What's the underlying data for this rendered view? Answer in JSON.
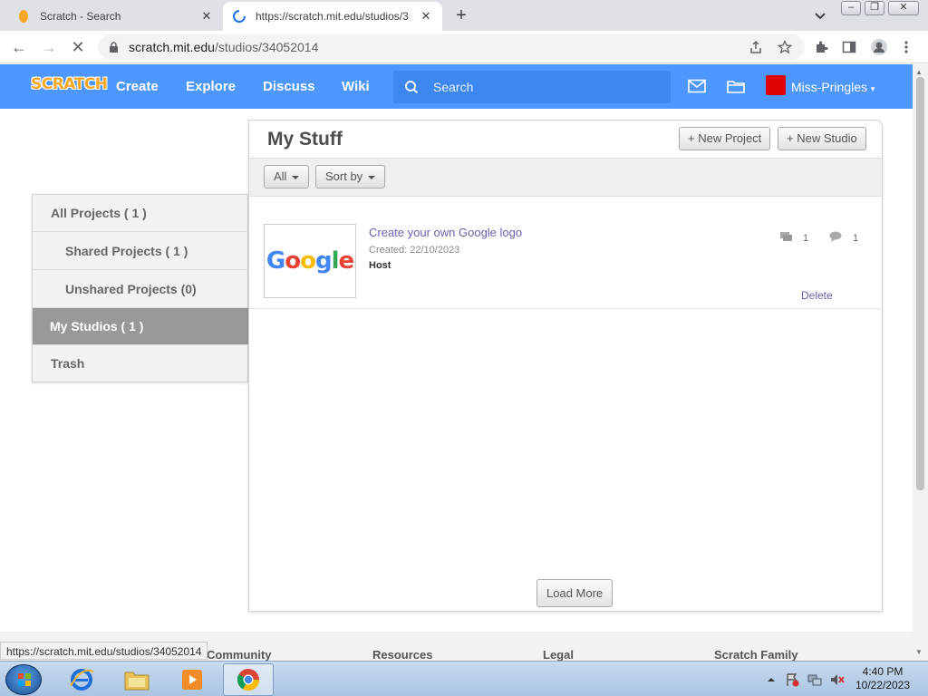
{
  "browser": {
    "tabs": [
      {
        "title": "Scratch - Search",
        "active": false
      },
      {
        "title": "https://scratch.mit.edu/studios/3",
        "active": true
      }
    ],
    "url_host": "scratch.mit.edu",
    "url_path": "/studios/34052014",
    "status_url": "https://scratch.mit.edu/studios/34052014"
  },
  "scratch_nav": {
    "logo": "SCRATCH",
    "links": [
      "Create",
      "Explore",
      "Discuss",
      "Wiki"
    ],
    "search_placeholder": "Search",
    "username": "Miss-Pringles"
  },
  "sidebar": {
    "items": [
      {
        "label": "All Projects ( 1 )",
        "selected": false
      },
      {
        "label": "Shared Projects ( 1 )",
        "selected": false
      },
      {
        "label": "Unshared Projects (0)",
        "selected": false
      },
      {
        "label": "My Studios ( 1 )",
        "selected": true
      },
      {
        "label": "Trash",
        "selected": false
      }
    ]
  },
  "main": {
    "title": "My Stuff",
    "new_project": "+ New Project",
    "new_studio": "+ New Studio",
    "filter_all": "All",
    "sort_by": "Sort by",
    "item": {
      "thumb_text": "Google",
      "title": "Create your own Google logo",
      "created": "Created: 22/10/2023",
      "role": "Host",
      "projects_count": "1",
      "comments_count": "1",
      "delete": "Delete"
    },
    "load_more": "Load More"
  },
  "footer": {
    "headings": [
      "Community",
      "Resources",
      "Legal",
      "Scratch Family"
    ]
  },
  "taskbar": {
    "time": "4:40 PM",
    "date": "10/22/2023"
  },
  "colors": {
    "scratch_blue": "#4d97ff",
    "link_purple": "#6e5fb0",
    "selected_gray": "#999999"
  }
}
